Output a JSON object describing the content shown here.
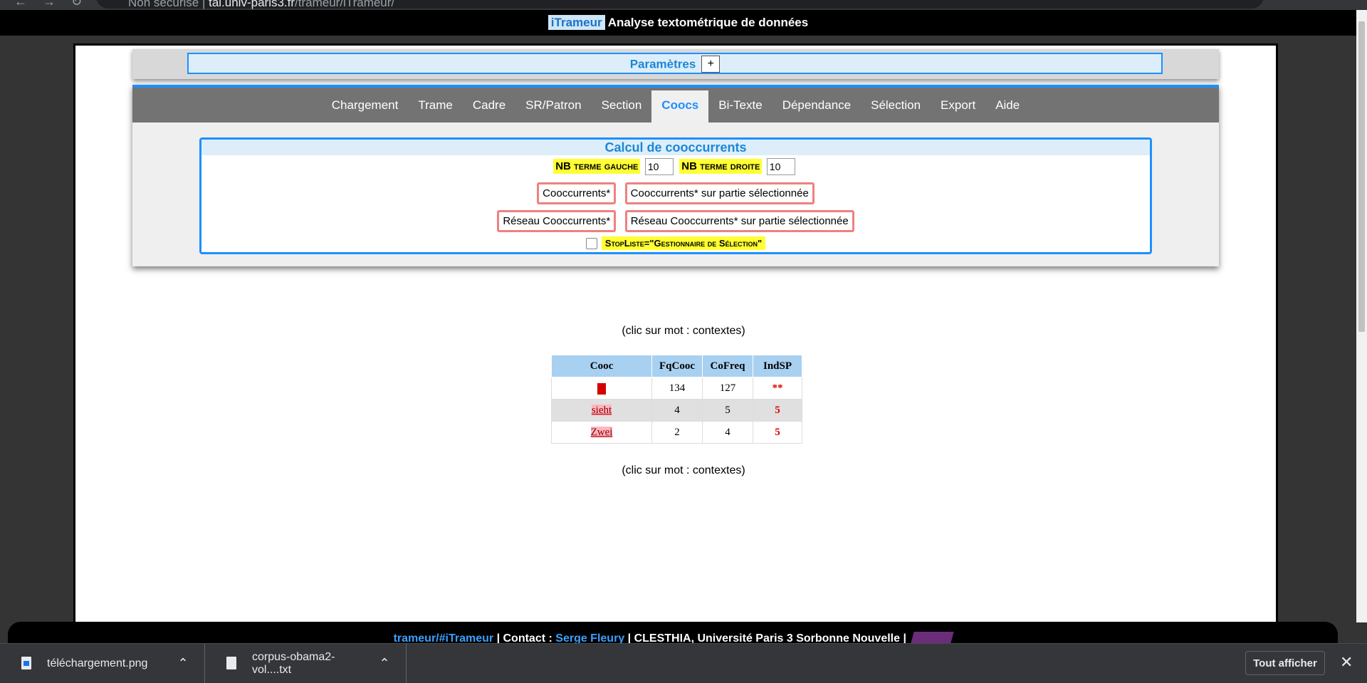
{
  "browser": {
    "security": "Non sécurisé",
    "url_host": "tal.univ-paris3.fr",
    "url_path": "/trameur/iTrameur/"
  },
  "header": {
    "brand": "iTrameur",
    "title": "Analyse textométrique de données"
  },
  "params": {
    "title": "Paramètres",
    "toggle": "+"
  },
  "tabs": [
    {
      "label": "Chargement",
      "active": false
    },
    {
      "label": "Trame",
      "active": false
    },
    {
      "label": "Cadre",
      "active": false
    },
    {
      "label": "SR/Patron",
      "active": false
    },
    {
      "label": "Section",
      "active": false
    },
    {
      "label": "Coocs",
      "active": true
    },
    {
      "label": "Bi-Texte",
      "active": false
    },
    {
      "label": "Dépendance",
      "active": false
    },
    {
      "label": "Sélection",
      "active": false
    },
    {
      "label": "Export",
      "active": false
    },
    {
      "label": "Aide",
      "active": false
    }
  ],
  "calc": {
    "title": "Calcul de cooccurrents",
    "left_label": "NB terme gauche",
    "left_value": "10",
    "right_label": "NB terme droite",
    "right_value": "10",
    "btn_coocs": "Cooccurrents*",
    "btn_coocs_sel": "Cooccurrents* sur partie sélectionnée",
    "btn_reseau": "Réseau Cooccurrents*",
    "btn_reseau_sel": "Réseau Cooccurrents* sur partie sélectionnée",
    "stoplist_label": "StopListe=\"Gestionnaire de Sélection\"",
    "stoplist_checked": false
  },
  "hint": "(clic sur mot : contextes)",
  "table": {
    "headers": [
      "Cooc",
      "FqCooc",
      "CoFreq",
      "IndSP"
    ],
    "rows": [
      {
        "cooc": "",
        "fq": "134",
        "cof": "127",
        "ind": "**"
      },
      {
        "cooc": "sieht",
        "fq": "4",
        "cof": "5",
        "ind": "5"
      },
      {
        "cooc": "Zwei",
        "fq": "2",
        "cof": "4",
        "ind": "5"
      }
    ]
  },
  "footer": {
    "link1": "trameur/#iTrameur",
    "contact_label": "Contact :",
    "contact_name": "Serge Fleury",
    "org": "CLESTHIA, Université Paris 3 Sorbonne Nouvelle"
  },
  "downloads": {
    "items": [
      {
        "name": "téléchargement.png"
      },
      {
        "name": "corpus-obama2-vol....txt"
      }
    ],
    "show_all": "Tout afficher",
    "close": "✕"
  }
}
